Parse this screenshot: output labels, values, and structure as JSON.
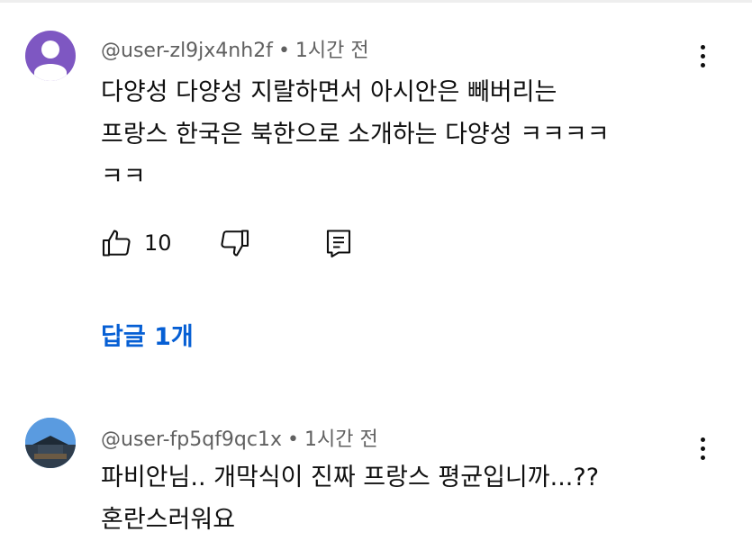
{
  "comments": [
    {
      "author": "@user-zl9jx4nh2f",
      "separator": "•",
      "time": "1시간 전",
      "body_lines": [
        "다양성 다양성 지랄하면서 아시안은 빼버리는",
        "프랑스 한국은 북한으로 소개하는 다양성 ㅋㅋㅋㅋ",
        "ㅋㅋ"
      ],
      "like_count": "10",
      "replies_label": "답글 1개",
      "avatar_color": "#7e57c2"
    },
    {
      "author": "@user-fp5qf9qc1x",
      "separator": "•",
      "time": "1시간 전",
      "body_lines": [
        "파비안님.. 개막식이 진짜 프랑스 평균입니까...??",
        "혼란스러워요"
      ],
      "avatar_color": "#4a90d9"
    }
  ],
  "icons": {
    "like": "thumbs-up-icon",
    "dislike": "thumbs-down-icon",
    "reply": "reply-icon",
    "menu": "more-vert-icon",
    "avatar_default": "person-icon"
  },
  "colors": {
    "link": "#065fd4",
    "meta_text": "#606060",
    "body_text": "#0f0f0f"
  }
}
